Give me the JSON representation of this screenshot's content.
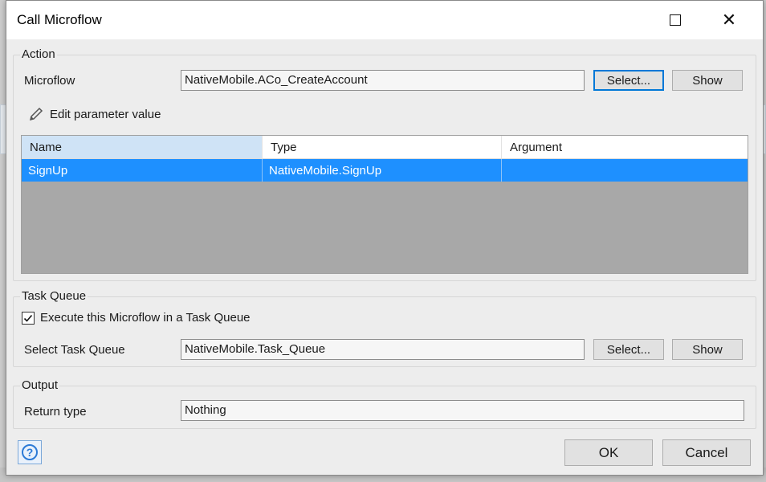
{
  "window": {
    "title": "Call Microflow"
  },
  "action": {
    "group_label": "Action",
    "microflow_label": "Microflow",
    "microflow_value": "NativeMobile.ACo_CreateAccount",
    "select_label": "Select...",
    "show_label": "Show",
    "edit_param_label": "Edit parameter value"
  },
  "params_table": {
    "columns": [
      "Name",
      "Type",
      "Argument"
    ],
    "rows": [
      {
        "name": "SignUp",
        "type": "NativeMobile.SignUp",
        "argument": ""
      }
    ]
  },
  "task_queue": {
    "group_label": "Task Queue",
    "execute_label": "Execute this Microflow in a Task Queue",
    "execute_checked": true,
    "select_queue_label": "Select Task Queue",
    "queue_value": "NativeMobile.Task_Queue",
    "select_label": "Select...",
    "show_label": "Show"
  },
  "output": {
    "group_label": "Output",
    "return_type_label": "Return type",
    "return_type_value": "Nothing"
  },
  "footer": {
    "ok_label": "OK",
    "cancel_label": "Cancel"
  },
  "colors": {
    "selection": "#1e90ff",
    "header_selected": "#cfe3f6",
    "focus_border": "#0078d7"
  }
}
